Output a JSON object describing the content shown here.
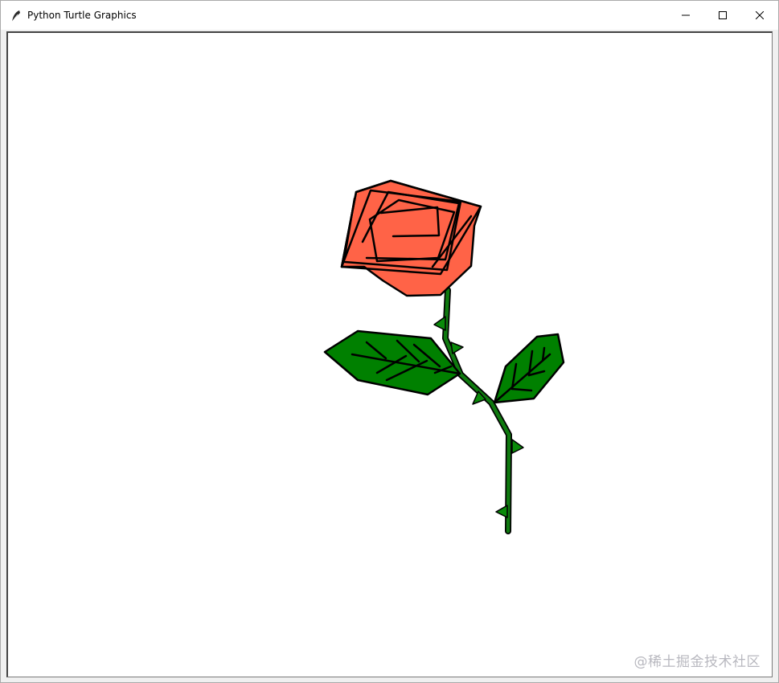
{
  "window": {
    "title": "Python Turtle Graphics",
    "icon": "feather-icon",
    "controls": {
      "minimize": "minimize-icon",
      "maximize": "maximize-icon",
      "close": "close-icon"
    }
  },
  "canvas": {
    "background": "#ffffff",
    "colors": {
      "petal": "#ff6347",
      "leaf": "#008000",
      "outline": "#000000"
    }
  },
  "watermark": {
    "text": "@稀土掘金技术社区"
  }
}
